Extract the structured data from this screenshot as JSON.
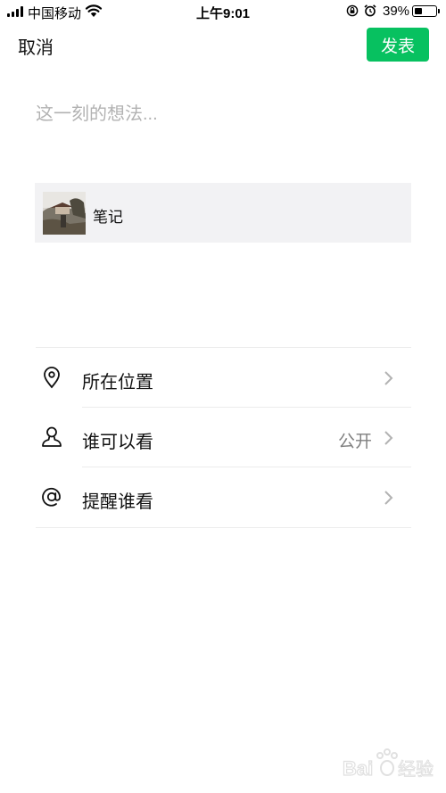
{
  "status_bar": {
    "carrier": "中国移动",
    "time": "上午9:01",
    "battery_percent": "39%",
    "battery_level": 0.39
  },
  "nav": {
    "cancel_label": "取消",
    "post_label": "发表",
    "accent_color": "#07c160"
  },
  "compose": {
    "placeholder": "这一刻的想法..."
  },
  "share_card": {
    "title": "笔记"
  },
  "options": [
    {
      "icon": "location-pin-icon",
      "label": "所在位置",
      "value": ""
    },
    {
      "icon": "person-icon",
      "label": "谁可以看",
      "value": "公开"
    },
    {
      "icon": "at-sign-icon",
      "label": "提醒谁看",
      "value": ""
    }
  ],
  "watermark": {
    "text": "Bai 经验"
  }
}
